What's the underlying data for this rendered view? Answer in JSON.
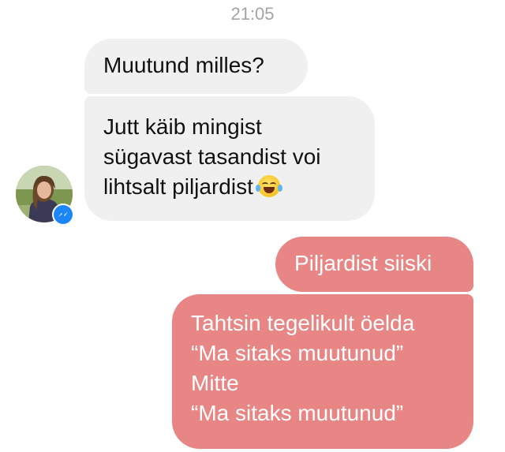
{
  "chat": {
    "timestamp": "21:05",
    "colors": {
      "incoming_bubble": "#f1f0f0",
      "outgoing_bubble": "#e88585",
      "outgoing_text": "#ffffff",
      "messenger_badge": "#1b86f8"
    },
    "messages": [
      {
        "side": "incoming",
        "lines": [
          "Muutund milles?"
        ]
      },
      {
        "side": "incoming",
        "lines": [
          "Jutt käib mingist",
          "sügavast tasandist voi",
          "lihtsalt piljardist"
        ],
        "emoji": "face-with-tears-of-joy"
      },
      {
        "side": "outgoing",
        "lines": [
          "Piljardist siiski"
        ]
      },
      {
        "side": "outgoing",
        "lines": [
          "Tahtsin tegelikult öelda",
          "“Ma sitaks muutunud”",
          "Mitte",
          "“Ma sitaks muutunud”"
        ]
      }
    ],
    "sender_avatar_icon": "avatar-photo",
    "badge_icon": "messenger-icon"
  }
}
